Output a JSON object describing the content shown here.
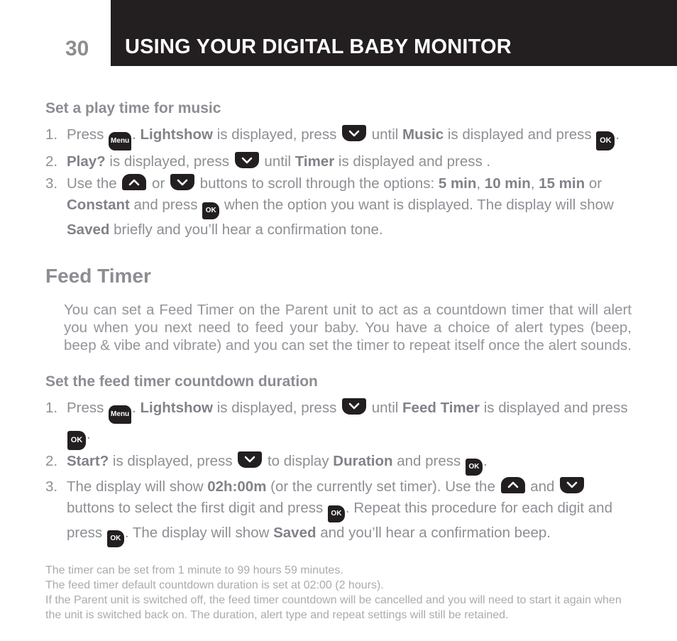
{
  "header": {
    "page_number": "30",
    "title": "USING YOUR DIGITAL BABY MONITOR",
    "bar_color": "#231f20",
    "title_color": "#ffffff",
    "page_number_color": "#8e8e8e"
  },
  "icons": {
    "menu_label": "Menu",
    "ok_label": "OK",
    "chevron_down": "chevron-down-icon",
    "chevron_up": "chevron-up-icon"
  },
  "section_music": {
    "heading": "Set a play time for music",
    "steps": [
      {
        "num": "1.",
        "parts": [
          {
            "t": "text",
            "v": "Press "
          },
          {
            "t": "key-menu"
          },
          {
            "t": "text",
            "v": ". "
          },
          {
            "t": "bold",
            "v": "Lightshow"
          },
          {
            "t": "text",
            "v": " is displayed, press "
          },
          {
            "t": "key-down"
          },
          {
            "t": "text",
            "v": " until "
          },
          {
            "t": "bold",
            "v": "Music"
          },
          {
            "t": "text",
            "v": " is displayed and press "
          },
          {
            "t": "key-ok"
          },
          {
            "t": "text",
            "v": "."
          }
        ]
      },
      {
        "num": "2.",
        "parts": [
          {
            "t": "bold",
            "v": "Play?"
          },
          {
            "t": "text",
            "v": " is displayed, press "
          },
          {
            "t": "key-down"
          },
          {
            "t": "text",
            "v": " until "
          },
          {
            "t": "bold",
            "v": "Timer"
          },
          {
            "t": "text",
            "v": " is displayed and press ."
          }
        ]
      },
      {
        "num": "3.",
        "parts": [
          {
            "t": "text",
            "v": "Use the "
          },
          {
            "t": "key-up"
          },
          {
            "t": "text",
            "v": " or "
          },
          {
            "t": "key-down"
          },
          {
            "t": "text",
            "v": " buttons to scroll through the options: "
          },
          {
            "t": "bold",
            "v": "5 min"
          },
          {
            "t": "text",
            "v": ", "
          },
          {
            "t": "bold",
            "v": "10 min"
          },
          {
            "t": "text",
            "v": ", "
          },
          {
            "t": "bold",
            "v": "15 min"
          },
          {
            "t": "text",
            "v": " or "
          },
          {
            "t": "bold",
            "v": "Constant"
          },
          {
            "t": "text",
            "v": " and press "
          },
          {
            "t": "key-ok-small"
          },
          {
            "t": "text",
            "v": " when the option you want is displayed. The display will show "
          },
          {
            "t": "bold",
            "v": "Saved"
          },
          {
            "t": "text",
            "v": " briefly and you’ll hear a confirmation tone."
          }
        ]
      }
    ]
  },
  "section_feed_timer": {
    "heading": "Feed Timer",
    "paragraph": "You can set a Feed Timer on the Parent unit to act as a countdown timer that will alert you when you next need to feed your baby. You have a choice of alert types (beep, beep & vibe and vibrate) and you can set the timer to repeat itself once the alert sounds."
  },
  "section_duration": {
    "heading": "Set the feed timer countdown duration",
    "steps": [
      {
        "num": "1.",
        "parts": [
          {
            "t": "text",
            "v": "Press "
          },
          {
            "t": "key-menu"
          },
          {
            "t": "text",
            "v": ". "
          },
          {
            "t": "bold",
            "v": "Lightshow"
          },
          {
            "t": "text",
            "v": " is displayed, press "
          },
          {
            "t": "key-down"
          },
          {
            "t": "text",
            "v": " until "
          },
          {
            "t": "bold",
            "v": "Feed Timer"
          },
          {
            "t": "text",
            "v": " is displayed and press "
          },
          {
            "t": "key-ok"
          },
          {
            "t": "text",
            "v": "."
          }
        ]
      },
      {
        "num": "2.",
        "parts": [
          {
            "t": "bold",
            "v": "Start?"
          },
          {
            "t": "text",
            "v": " is displayed, press "
          },
          {
            "t": "key-down"
          },
          {
            "t": "text",
            "v": " to display "
          },
          {
            "t": "bold",
            "v": "Duration"
          },
          {
            "t": "text",
            "v": " and press "
          },
          {
            "t": "key-ok-small"
          },
          {
            "t": "text",
            "v": "."
          }
        ]
      },
      {
        "num": "3.",
        "parts": [
          {
            "t": "text",
            "v": "The display will show "
          },
          {
            "t": "bold",
            "v": "02h:00m"
          },
          {
            "t": "text",
            "v": " (or the currently set timer). Use the "
          },
          {
            "t": "key-up"
          },
          {
            "t": "text",
            "v": " and "
          },
          {
            "t": "key-down"
          },
          {
            "t": "text",
            "v": " buttons to select the first digit and press "
          },
          {
            "t": "key-ok-small"
          },
          {
            "t": "text",
            "v": ". Repeat this procedure for each digit and press "
          },
          {
            "t": "key-ok-small"
          },
          {
            "t": "text",
            "v": ". The display will show "
          },
          {
            "t": "bold",
            "v": "Saved"
          },
          {
            "t": "text",
            "v": " and you’ll hear a confirmation beep."
          }
        ]
      }
    ]
  },
  "notes": [
    "The timer can be set from 1 minute to 99 hours 59 minutes.",
    "The feed timer default countdown duration is set at 02:00 (2 hours).",
    "If the Parent unit is switched off, the feed timer countdown will be cancelled and you will need to start it again when the unit is switched back on. The duration, alert type and repeat settings will still be retained."
  ]
}
